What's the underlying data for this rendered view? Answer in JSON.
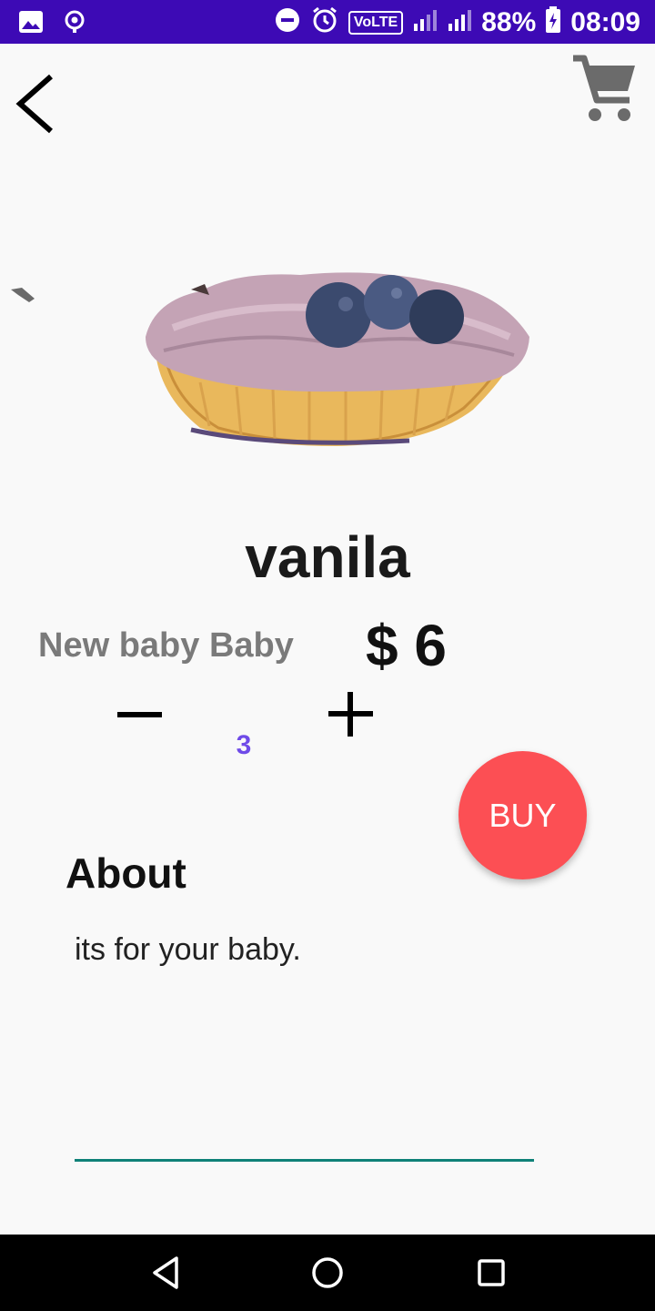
{
  "status_bar": {
    "volte": "VoLTE",
    "battery": "88%",
    "time": "08:09"
  },
  "toolbar": {
    "back_icon": "chevron-left-icon",
    "cart_icon": "shopping-cart-icon"
  },
  "product": {
    "image_icon": "cupcake-image",
    "name": "vanila",
    "subtitle": "New baby Baby",
    "price": "$ 6",
    "quantity": "3"
  },
  "actions": {
    "minus_icon": "minus-icon",
    "plus_icon": "plus-icon",
    "buy_label": "BUY"
  },
  "about": {
    "heading": "About",
    "text": "its for your baby."
  },
  "colors": {
    "status_bar": "#3d0ab5",
    "buy_button": "#fc4f54",
    "quantity": "#6f4be8",
    "underline": "#0f8178"
  }
}
